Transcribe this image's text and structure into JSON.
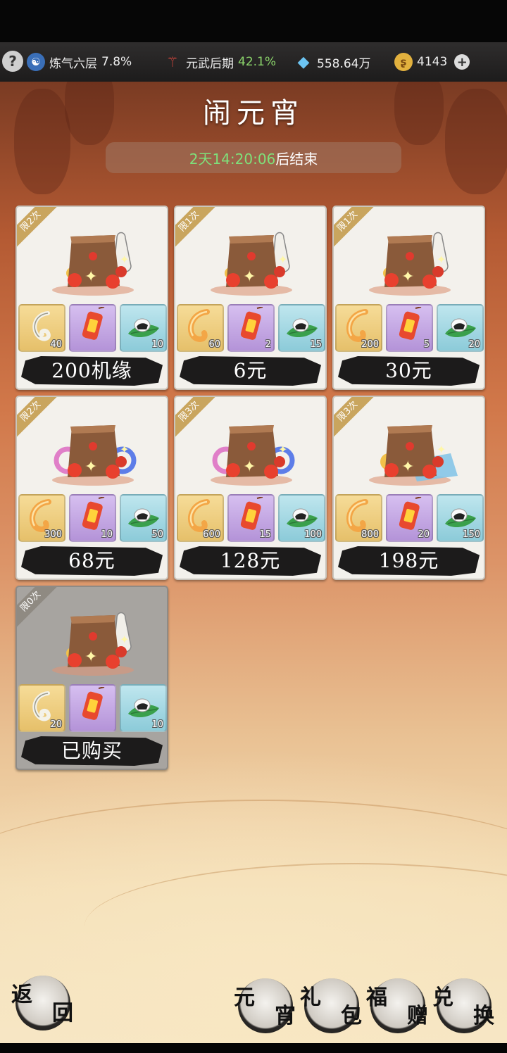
{
  "status": {
    "help_label": "?",
    "cultivation": {
      "name": "炼气六层",
      "pct": "7.8%"
    },
    "martial": {
      "name": "元武后期",
      "pct": "42.1%"
    },
    "crystals": "558.64万",
    "coins": "4143",
    "plus_label": "+"
  },
  "title": "闹元宵",
  "timer": {
    "value": "2天14:20:06",
    "suffix": "后结束"
  },
  "cards": [
    {
      "limit": "限2次",
      "price": "200机缘",
      "pack": "bag-jar",
      "items": [
        {
          "icon": "silver-hook-icon",
          "color": "gold",
          "qty": "40"
        },
        {
          "icon": "lantern-icon",
          "color": "purple",
          "qty": ""
        },
        {
          "icon": "rice-ball-icon",
          "color": "blue",
          "qty": "10"
        }
      ]
    },
    {
      "limit": "限1次",
      "price": "6元",
      "pack": "bag-jar",
      "items": [
        {
          "icon": "golden-hook-icon",
          "color": "gold",
          "qty": "60"
        },
        {
          "icon": "lantern-icon",
          "color": "purple",
          "qty": "2"
        },
        {
          "icon": "rice-ball-icon",
          "color": "blue",
          "qty": "15"
        }
      ]
    },
    {
      "limit": "限1次",
      "price": "30元",
      "pack": "bag-jar",
      "items": [
        {
          "icon": "golden-hook-icon",
          "color": "gold",
          "qty": "200"
        },
        {
          "icon": "lantern-icon",
          "color": "purple",
          "qty": "5"
        },
        {
          "icon": "rice-ball-icon",
          "color": "blue",
          "qty": "20"
        }
      ]
    },
    {
      "limit": "限2次",
      "price": "68元",
      "pack": "bag-rings",
      "items": [
        {
          "icon": "golden-hook-icon",
          "color": "gold",
          "qty": "300"
        },
        {
          "icon": "lantern-icon",
          "color": "purple",
          "qty": "10"
        },
        {
          "icon": "rice-ball-icon",
          "color": "blue",
          "qty": "50"
        }
      ]
    },
    {
      "limit": "限3次",
      "price": "128元",
      "pack": "bag-rings",
      "items": [
        {
          "icon": "golden-hook-icon",
          "color": "gold",
          "qty": "600"
        },
        {
          "icon": "lantern-icon",
          "color": "purple",
          "qty": "15"
        },
        {
          "icon": "rice-ball-icon",
          "color": "blue",
          "qty": "100"
        }
      ]
    },
    {
      "limit": "限3次",
      "price": "198元",
      "pack": "bag-cloth",
      "items": [
        {
          "icon": "golden-hook-icon",
          "color": "gold",
          "qty": "800"
        },
        {
          "icon": "lantern-icon",
          "color": "purple",
          "qty": "20"
        },
        {
          "icon": "rice-ball-icon",
          "color": "blue",
          "qty": "150"
        }
      ]
    },
    {
      "limit": "限0次",
      "price": "已购买",
      "pack": "bag-jar",
      "sold": true,
      "items": [
        {
          "icon": "silver-hook-icon",
          "color": "gold",
          "qty": "20"
        },
        {
          "icon": "lantern-icon",
          "color": "purple",
          "qty": ""
        },
        {
          "icon": "rice-ball-icon",
          "color": "blue",
          "qty": "10"
        }
      ]
    }
  ],
  "nav": {
    "back": [
      "返",
      "回"
    ],
    "yuanxiao": [
      "元",
      "宵"
    ],
    "gift": [
      "礼",
      "包"
    ],
    "blessing": [
      "福",
      "赠"
    ],
    "exchange": [
      "兑",
      "换"
    ]
  }
}
